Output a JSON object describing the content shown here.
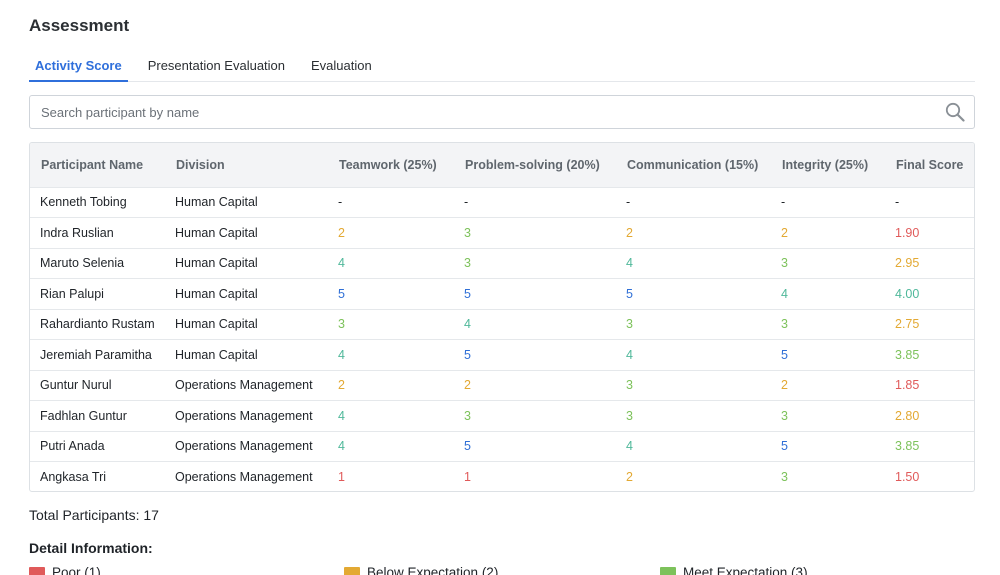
{
  "title": "Assessment",
  "tabs": [
    {
      "label": "Activity Score",
      "active": true
    },
    {
      "label": "Presentation Evaluation",
      "active": false
    },
    {
      "label": "Evaluation",
      "active": false
    }
  ],
  "search": {
    "placeholder": "Search participant by name",
    "value": "",
    "icon": "search-icon"
  },
  "colors": {
    "poor": "#e05a5a",
    "below": "#e3a933",
    "meet": "#7dc25b",
    "exceed": "#4fb89a",
    "outstanding": "#2f6fd6",
    "neutral": "#1f2328"
  },
  "score_colors": {
    "-": "#1f2328",
    "1": "#e05a5a",
    "2": "#e3a933",
    "3": "#7dc25b",
    "4": "#4fb89a",
    "5": "#2f6fd6"
  },
  "table": {
    "columns": [
      "Participant Name",
      "Division",
      "Teamwork (25%)",
      "Problem-solving (20%)",
      "Communication (15%)",
      "Integrity (25%)",
      "Final Score"
    ],
    "rows": [
      {
        "name": "Kenneth Tobing",
        "division": "Human Capital",
        "teamwork": "-",
        "problem": "-",
        "communication": "-",
        "integrity": "-",
        "final": "-",
        "final_level": "-"
      },
      {
        "name": "Indra Ruslian",
        "division": "Human Capital",
        "teamwork": "2",
        "problem": "3",
        "communication": "2",
        "integrity": "2",
        "final": "1.90",
        "final_level": "1"
      },
      {
        "name": "Maruto Selenia",
        "division": "Human Capital",
        "teamwork": "4",
        "problem": "3",
        "communication": "4",
        "integrity": "3",
        "final": "2.95",
        "final_level": "2"
      },
      {
        "name": "Rian Palupi",
        "division": "Human Capital",
        "teamwork": "5",
        "problem": "5",
        "communication": "5",
        "integrity": "4",
        "final": "4.00",
        "final_level": "4"
      },
      {
        "name": "Rahardianto Rustam",
        "division": "Human Capital",
        "teamwork": "3",
        "problem": "4",
        "communication": "3",
        "integrity": "3",
        "final": "2.75",
        "final_level": "2"
      },
      {
        "name": "Jeremiah Paramitha",
        "division": "Human Capital",
        "teamwork": "4",
        "problem": "5",
        "communication": "4",
        "integrity": "5",
        "final": "3.85",
        "final_level": "3"
      },
      {
        "name": "Guntur Nurul",
        "division": "Operations Management",
        "teamwork": "2",
        "problem": "2",
        "communication": "3",
        "integrity": "2",
        "final": "1.85",
        "final_level": "1"
      },
      {
        "name": "Fadhlan Guntur",
        "division": "Operations Management",
        "teamwork": "4",
        "problem": "3",
        "communication": "3",
        "integrity": "3",
        "final": "2.80",
        "final_level": "2"
      },
      {
        "name": "Putri Anada",
        "division": "Operations Management",
        "teamwork": "4",
        "problem": "5",
        "communication": "4",
        "integrity": "5",
        "final": "3.85",
        "final_level": "3"
      },
      {
        "name": "Angkasa Tri",
        "division": "Operations Management",
        "teamwork": "1",
        "problem": "1",
        "communication": "2",
        "integrity": "3",
        "final": "1.50",
        "final_level": "1"
      }
    ]
  },
  "total_participants": "Total Participants: 17",
  "detail_heading": "Detail Information:",
  "legend": [
    {
      "label": "Poor (1)",
      "color": "#e05a5a"
    },
    {
      "label": "Below Expectation (2)",
      "color": "#e3a933"
    },
    {
      "label": "Meet Expectation (3)",
      "color": "#7dc25b"
    }
  ]
}
